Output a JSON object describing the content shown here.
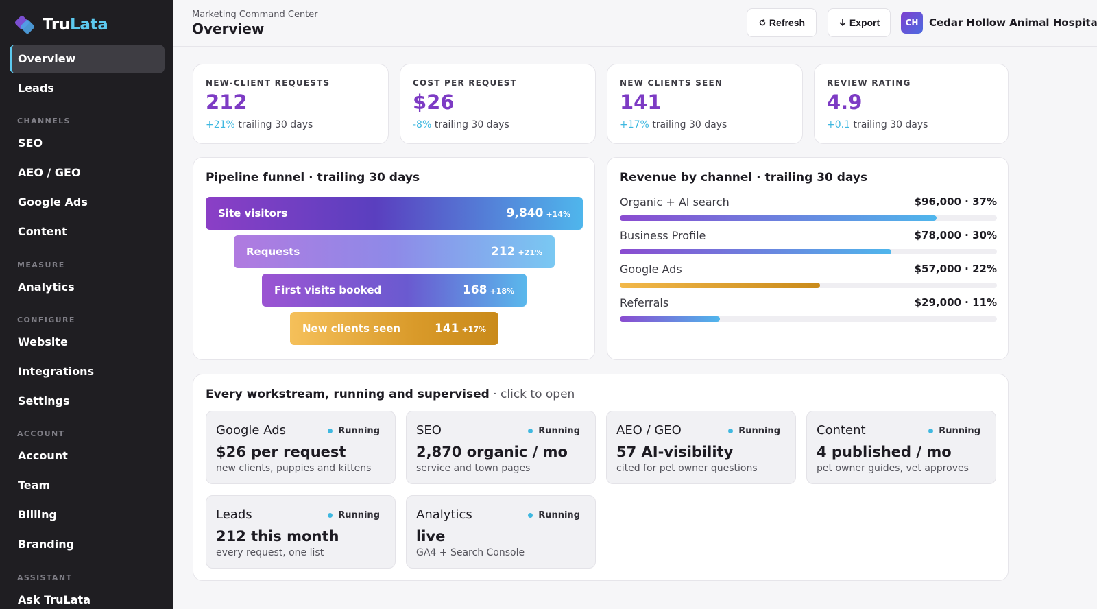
{
  "brand": {
    "name_part1": "Tru",
    "name_part2": "Lata"
  },
  "sidebar": {
    "items": {
      "overview": "Overview",
      "leads": "Leads",
      "seo": "SEO",
      "aeo": "AEO / GEO",
      "google_ads": "Google Ads",
      "content": "Content",
      "analytics": "Analytics",
      "website": "Website",
      "integrations": "Integrations",
      "settings": "Settings",
      "account": "Account",
      "team": "Team",
      "billing": "Billing",
      "branding": "Branding",
      "ask": "Ask TruLata"
    },
    "sections": {
      "channels": "CHANNELS",
      "measure": "MEASURE",
      "configure": "CONFIGURE",
      "account": "ACCOUNT",
      "assistant": "ASSISTANT"
    },
    "active_item": "Overview"
  },
  "header": {
    "subtitle": "Marketing Command Center",
    "title": "Overview",
    "refresh_label": "Refresh",
    "export_label": "Export",
    "avatar_initials": "CH",
    "org_name": "Cedar Hollow Animal Hospital"
  },
  "kpis": [
    {
      "label": "NEW-CLIENT REQUESTS",
      "value": "212",
      "delta": "+21%",
      "period": "trailing 30 days"
    },
    {
      "label": "COST PER REQUEST",
      "value": "$26",
      "delta": "-8%",
      "period": "trailing 30 days"
    },
    {
      "label": "NEW CLIENTS SEEN",
      "value": "141",
      "delta": "+17%",
      "period": "trailing 30 days"
    },
    {
      "label": "REVIEW RATING",
      "value": "4.9",
      "delta": "+0.1",
      "period": "trailing 30 days"
    }
  ],
  "funnel": {
    "title": "Pipeline funnel · trailing 30 days",
    "stages": [
      {
        "label": "Site visitors",
        "value": "9,840",
        "delta": "+14%"
      },
      {
        "label": "Requests",
        "value": "212",
        "delta": "+21%"
      },
      {
        "label": "First visits booked",
        "value": "168",
        "delta": "+18%"
      },
      {
        "label": "New clients seen",
        "value": "141",
        "delta": "+17%"
      }
    ]
  },
  "revenue": {
    "title": "Revenue by channel · trailing 30 days",
    "channels": [
      {
        "name": "Organic + AI search",
        "amount": "$96,000 · 37%",
        "share": 0.84
      },
      {
        "name": "Business Profile",
        "amount": "$78,000 · 30%",
        "share": 0.72
      },
      {
        "name": "Google Ads",
        "amount": "$57,000 · 22%",
        "share": 0.53
      },
      {
        "name": "Referrals",
        "amount": "$29,000 · 11%",
        "share": 0.265
      }
    ],
    "colors": {
      "purple_blue": [
        "#8a4bd0",
        "#4fb6ec"
      ],
      "gold": [
        "#f2b84a",
        "#c98a1a"
      ],
      "track": "#efeef2"
    }
  },
  "workstreams": {
    "title": "Every workstream, running and supervised",
    "title_suffix": " · click to open",
    "items": [
      {
        "name": "Google Ads",
        "status": "Running",
        "metric": "$26 per request",
        "sub": "new clients, puppies and kittens"
      },
      {
        "name": "SEO",
        "status": "Running",
        "metric": "2,870 organic / mo",
        "sub": "service and town pages"
      },
      {
        "name": "AEO / GEO",
        "status": "Running",
        "metric": "57 AI-visibility",
        "sub": "cited for pet owner questions"
      },
      {
        "name": "Content",
        "status": "Running",
        "metric": "4 published / mo",
        "sub": "pet owner guides, vet approves"
      },
      {
        "name": "Leads",
        "status": "Running",
        "metric": "212 this month",
        "sub": "every request, one list"
      },
      {
        "name": "Analytics",
        "status": "Running",
        "metric": "live",
        "sub": "GA4 + Search Console"
      }
    ]
  },
  "icons": {
    "refresh": "refresh-icon",
    "export": "download-arrow-icon",
    "status": "status-dot-icon",
    "logo": "trulata-logo-icon"
  },
  "accent_colors": {
    "primary_purple": "#7d3bc4",
    "accent_cyan": "#3fb8e0",
    "sidebar_bg": "#1f1e22"
  }
}
